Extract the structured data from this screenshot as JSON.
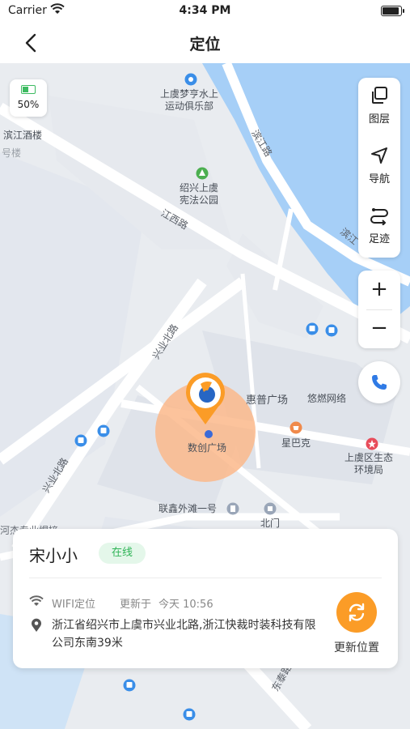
{
  "status_bar": {
    "carrier": "Carrier",
    "time": "4:34 PM"
  },
  "header": {
    "title": "定位"
  },
  "map": {
    "battery": {
      "percent_label": "50%",
      "level": 0.5,
      "color": "#3dbb61"
    },
    "labels": {
      "rowing_club": "上虞梦亨水上\n运动俱乐部",
      "binjiang_restaurant": "滨江酒楼",
      "hao_lou": "号楼",
      "constitution_park": "绍兴上虞\n宪法公园",
      "jiangxi_road": "江西路",
      "binjiang_road": "滨江路",
      "binjiang_road_2": "滨江",
      "xingye_north_road": "兴业北路",
      "xingye_north_road_2": "兴业北路",
      "huipu_plaza": "惠普广场",
      "yourang_network": "悠燃网络",
      "shuchuang_plaza": "数创广场",
      "starbucks": "星巴克",
      "eco_bureau": "上虞区生态\n环境局",
      "lianxin_bund": "联鑫外滩一号",
      "north_gate": "北门",
      "industrial_store": "河杰专业焊接",
      "dongtai_road": "东泰路"
    }
  },
  "toolbar": {
    "layers": "图层",
    "navigate": "导航",
    "track": "足迹"
  },
  "zoom": {
    "in": "+",
    "out": "−"
  },
  "card": {
    "name": "宋小小",
    "status": "在线",
    "location_type": "WIFI定位",
    "update_prefix": "更新于",
    "update_time": "今天 10:56",
    "address": "浙江省绍兴市上虞市兴业北路,浙江快裁时装科技有限公司东南39米",
    "refresh_label": "更新位置"
  },
  "colors": {
    "water": "#a6cff7",
    "road": "#ffffff",
    "block": "#dde2ea",
    "accent_orange": "#fb9c27",
    "online_green": "#2fb457",
    "poi_blue": "#3a8ee8"
  }
}
